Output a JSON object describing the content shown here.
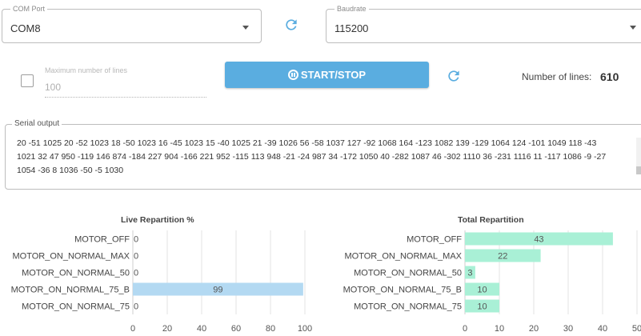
{
  "com_port": {
    "label": "COM Port",
    "value": "COM8"
  },
  "baudrate": {
    "label": "Baudrate",
    "value": "115200"
  },
  "max_lines": {
    "label": "Maximum number of lines",
    "value": "100",
    "checked": false
  },
  "start_stop": {
    "label": "START/STOP"
  },
  "line_count": {
    "label": "Number of lines:",
    "value": "610"
  },
  "serial": {
    "label": "Serial output",
    "text": "20 -51 1025 20 -52 1023 18 -50 1023 16 -45 1023 15 -40 1025 21 -39 1026 56 -58 1037 127 -92 1068 164 -123 1082 139 -129 1064 124 -101 1049 118 -43 1021 32 47 950 -119 146 874 -184 227 904 -166 221 952 -115 113 948 -21 -24 987 34 -172 1050 40 -282 1087 46 -302 1110 36 -231 1116 11 -117 1086 -9 -27 1054 -36 8 1036 -50 -5 1030"
  },
  "colors": {
    "accent": "#5aade0",
    "live_bar": "#b3d9f2",
    "total_bar": "#a9f0d6"
  },
  "chart_data": [
    {
      "type": "bar",
      "orientation": "horizontal",
      "title": "Live Repartition %",
      "categories": [
        "MOTOR_OFF",
        "MOTOR_ON_NORMAL_MAX",
        "MOTOR_ON_NORMAL_50",
        "MOTOR_ON_NORMAL_75_B",
        "MOTOR_ON_NORMAL_75"
      ],
      "values": [
        0,
        0,
        0,
        99,
        0
      ],
      "data_labels": [
        "0",
        "0",
        "0",
        "99",
        "0"
      ],
      "xlim": [
        0,
        100
      ],
      "xticks": [
        0,
        20,
        40,
        60,
        80,
        100
      ],
      "grid": true,
      "bar_color": "#b3d9f2"
    },
    {
      "type": "bar",
      "orientation": "horizontal",
      "title": "Total Repartition",
      "categories": [
        "MOTOR_OFF",
        "MOTOR_ON_NORMAL_MAX",
        "MOTOR_ON_NORMAL_50",
        "MOTOR_ON_NORMAL_75_B",
        "MOTOR_ON_NORMAL_75"
      ],
      "values": [
        43,
        22,
        3,
        10,
        10
      ],
      "data_labels": [
        "43",
        "22",
        "3",
        "10",
        "10"
      ],
      "xlim": [
        0,
        50
      ],
      "xticks": [
        0,
        10,
        20,
        30,
        40,
        50
      ],
      "grid": true,
      "bar_color": "#a9f0d6"
    }
  ]
}
